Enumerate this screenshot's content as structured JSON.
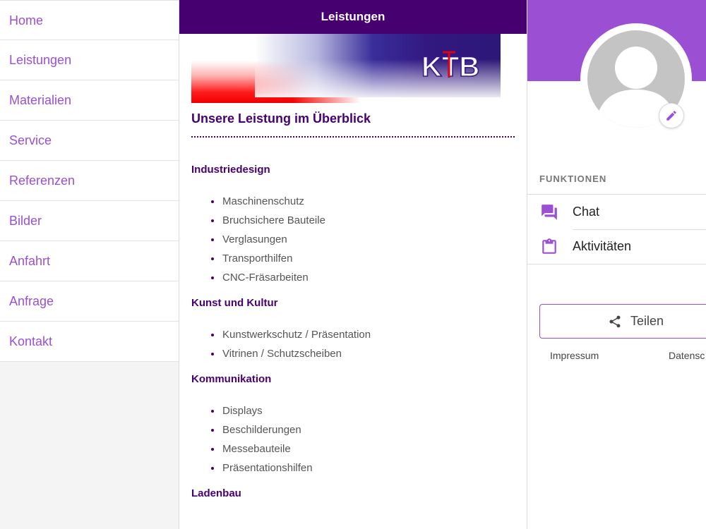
{
  "nav": {
    "items": [
      {
        "label": "Home"
      },
      {
        "label": "Leistungen"
      },
      {
        "label": "Materialien"
      },
      {
        "label": "Service"
      },
      {
        "label": "Referenzen"
      },
      {
        "label": "Bilder"
      },
      {
        "label": "Anfahrt"
      },
      {
        "label": "Anfrage"
      },
      {
        "label": "Kontakt"
      }
    ]
  },
  "content": {
    "header_title": "Leistungen",
    "logo_text": "KTB",
    "page_title": "Unsere Leistung im Überblick",
    "sections": [
      {
        "title": "Industriedesign",
        "items": [
          "Maschinenschutz",
          "Bruchsichere Bauteile",
          "Verglasungen",
          "Transporthilfen",
          "CNC-Fräsarbeiten"
        ]
      },
      {
        "title": "Kunst und Kultur",
        "items": [
          "Kunstwerkschutz / Präsentation",
          "Vitrinen / Schutzscheiben"
        ]
      },
      {
        "title": "Kommunikation",
        "items": [
          "Displays",
          "Beschilderungen",
          "Messebauteile",
          "Präsentationshilfen"
        ]
      },
      {
        "title": "Ladenbau",
        "items": []
      }
    ]
  },
  "profile": {
    "functions_label": "FUNKTIONEN",
    "functions": [
      {
        "label": "Chat",
        "icon": "chat-icon"
      },
      {
        "label": "Aktivitäten",
        "icon": "clipboard-icon"
      }
    ],
    "share_label": "Teilen",
    "footer_links": [
      "Impressum",
      "Datensc"
    ]
  },
  "colors": {
    "accent": "#9b4fd2",
    "header": "#470070",
    "text_muted": "#555555"
  }
}
